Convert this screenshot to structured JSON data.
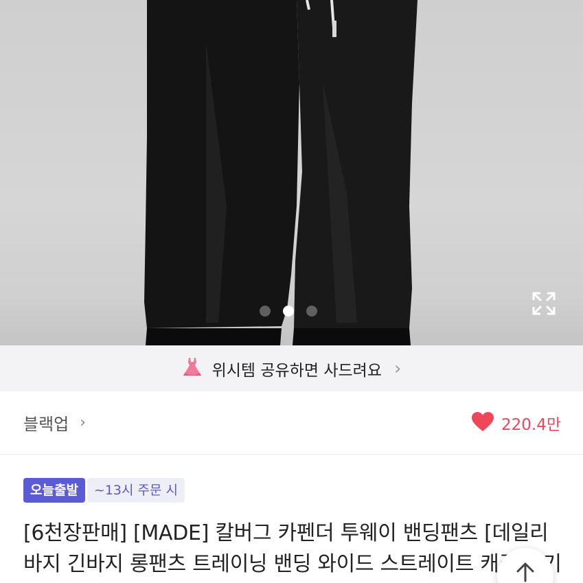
{
  "gallery": {
    "image_alt": "black wide banding pants product photo",
    "dot_count": 3,
    "active_index": 1
  },
  "wish_banner": {
    "text": "위시템 공유하면 사드려요",
    "icon": "dress-icon",
    "chevron": "›"
  },
  "seller": {
    "name": "블랙업",
    "chevron": "›"
  },
  "likes": {
    "icon": "heart-icon",
    "count": "220.4만",
    "color": "#f0465a"
  },
  "badges": {
    "delivery": "오늘출발",
    "cutoff": "~13시 주문 시"
  },
  "product": {
    "title": "[6천장판매] [MADE] 칼버그 카펜더 투웨이 밴딩팬츠 [데일리 바지 긴바지 롱팬츠 트레이닝 밴딩 와이드 스트레이트 캐주얼 기본]"
  },
  "colors": {
    "accent_delivery": "#5b5bd6",
    "heart": "#f0465a"
  }
}
